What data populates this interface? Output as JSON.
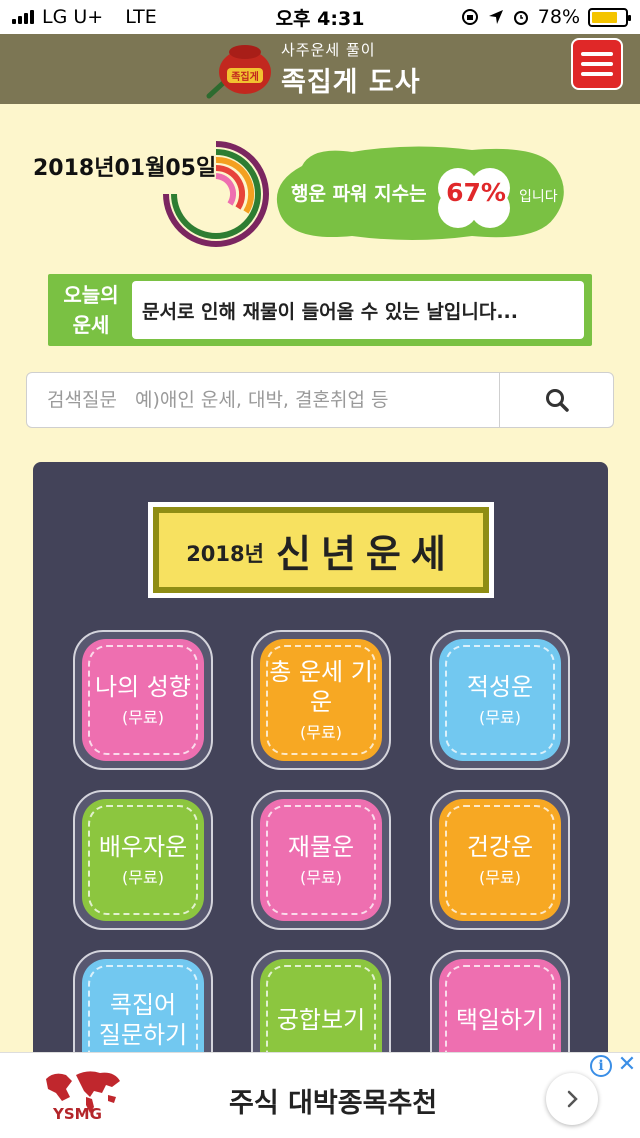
{
  "status_bar": {
    "carrier": "LG U+",
    "network": "LTE",
    "time": "오후 4:31",
    "battery": "78%"
  },
  "header": {
    "logo_subtitle": "사주운세 풀이",
    "logo_title": "족집게 도사",
    "logo_badge": "족집게",
    "menu_icon": "hamburger-icon"
  },
  "fortune": {
    "date": "2018년01월05일",
    "luck_prefix": "행운 파워 지수는",
    "luck_value": "67%",
    "luck_suffix": "입니다"
  },
  "today": {
    "label_line1": "오늘의",
    "label_line2": "운세",
    "message": "문서로 인해 재물이 들어올 수 있는 날입니다..."
  },
  "search": {
    "placeholder": "검색질문   예)애인 운세, 대박, 결혼취업 등",
    "icon": "search-icon"
  },
  "banner": {
    "year": "2018년",
    "title": "신년운세"
  },
  "menu_tiles": [
    {
      "label": "나의 성향",
      "sub": "(무료)",
      "color": "#ee6fb0"
    },
    {
      "label": "총 운세 기운",
      "sub": "(무료)",
      "color": "#f7a823"
    },
    {
      "label": "적성운",
      "sub": "(무료)",
      "color": "#72c8f0"
    },
    {
      "label": "배우자운",
      "sub": "(무료)",
      "color": "#8cc63f"
    },
    {
      "label": "재물운",
      "sub": "(무료)",
      "color": "#ee6fb0"
    },
    {
      "label": "건강운",
      "sub": "(무료)",
      "color": "#f7a823"
    },
    {
      "label_line1": "콕집어",
      "label_line2": "질문하기",
      "color": "#72c8f0"
    },
    {
      "label": "궁합보기",
      "color": "#8cc63f"
    },
    {
      "label": "택일하기",
      "color": "#ee6fb0"
    }
  ],
  "ad": {
    "brand": "YSMG",
    "text": "주식 대박종목추천",
    "info_icon": "info-icon",
    "close_icon": "close-icon",
    "arrow_icon": "chevron-right-icon"
  },
  "colors": {
    "header_bg": "#7c7654",
    "page_bg": "#fdf6cc",
    "panel_bg": "#434359",
    "green": "#7ac143",
    "menu_red": "#e02828"
  }
}
